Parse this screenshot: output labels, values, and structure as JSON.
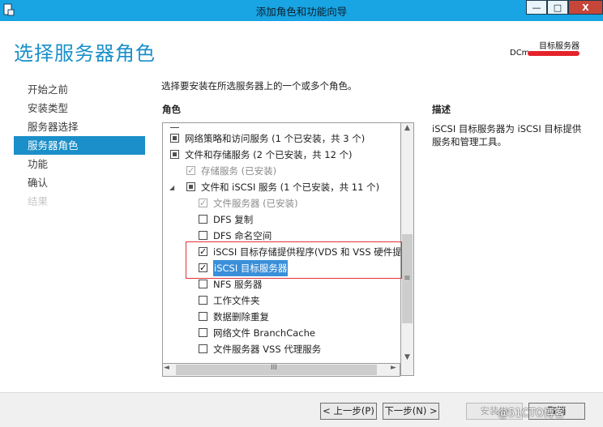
{
  "window": {
    "title": "添加角色和功能向导",
    "minimize": "—",
    "maximize": "□",
    "close": "X"
  },
  "header": {
    "page_title": "选择服务器角色",
    "target_label": "目标服务器",
    "target_name": "DCm"
  },
  "nav": {
    "items": [
      {
        "label": "开始之前",
        "state": "normal"
      },
      {
        "label": "安装类型",
        "state": "normal"
      },
      {
        "label": "服务器选择",
        "state": "normal"
      },
      {
        "label": "服务器角色",
        "state": "active"
      },
      {
        "label": "功能",
        "state": "normal"
      },
      {
        "label": "确认",
        "state": "normal"
      },
      {
        "label": "结果",
        "state": "disabled"
      }
    ]
  },
  "main": {
    "instruction": "选择要安装在所选服务器上的一个或多个角色。",
    "roles_heading": "角色",
    "description_heading": "描述",
    "description_text": "iSCSI 目标服务器为 iSCSI 目标提供服务和管理工具。",
    "roles": [
      {
        "label": "网络策略和访问服务 (1 个已安装，共 3 个)",
        "level": 0,
        "check": "partial",
        "expander": false,
        "dim": false,
        "selected": false
      },
      {
        "label": "文件和存储服务 (2 个已安装，共 12 个)",
        "level": 0,
        "check": "partial",
        "expander": false,
        "dim": false,
        "selected": false
      },
      {
        "label": "存储服务 (已安装)",
        "level": 1,
        "check": "checked-disabled",
        "expander": false,
        "dim": true,
        "selected": false
      },
      {
        "label": "文件和 iSCSI 服务 (1 个已安装，共 11 个)",
        "level": 1,
        "check": "partial",
        "expander": true,
        "dim": false,
        "selected": false
      },
      {
        "label": "文件服务器 (已安装)",
        "level": 2,
        "check": "checked-disabled",
        "expander": false,
        "dim": true,
        "selected": false
      },
      {
        "label": "DFS 复制",
        "level": 2,
        "check": "unchecked",
        "expander": false,
        "dim": false,
        "selected": false
      },
      {
        "label": "DFS 命名空间",
        "level": 2,
        "check": "unchecked",
        "expander": false,
        "dim": false,
        "selected": false
      },
      {
        "label": "iSCSI 目标存储提供程序(VDS 和 VSS 硬件提供",
        "level": 2,
        "check": "checked",
        "expander": false,
        "dim": false,
        "selected": false
      },
      {
        "label": "iSCSI 目标服务器",
        "level": 2,
        "check": "checked",
        "expander": false,
        "dim": false,
        "selected": true
      },
      {
        "label": "NFS 服务器",
        "level": 2,
        "check": "unchecked",
        "expander": false,
        "dim": false,
        "selected": false
      },
      {
        "label": "工作文件夹",
        "level": 2,
        "check": "unchecked",
        "expander": false,
        "dim": false,
        "selected": false
      },
      {
        "label": "数据删除重复",
        "level": 2,
        "check": "unchecked",
        "expander": false,
        "dim": false,
        "selected": false
      },
      {
        "label": "网络文件 BranchCache",
        "level": 2,
        "check": "unchecked",
        "expander": false,
        "dim": false,
        "selected": false
      },
      {
        "label": "文件服务器 VSS 代理服务",
        "level": 2,
        "check": "unchecked",
        "expander": false,
        "dim": false,
        "selected": false
      }
    ],
    "scroll_up": "▲",
    "scroll_down": "▼",
    "scroll_left": "◄",
    "scroll_right": "►",
    "scroll_grip_v": "≡",
    "scroll_grip_h": "III"
  },
  "footer": {
    "prev": "< 上一步(P)",
    "next": "下一步(N) >",
    "install": "安装(I)",
    "cancel": "取消",
    "watermark": "@51CTO博客"
  },
  "colors": {
    "accent": "#1a8fc9",
    "titlebar": "#19a4e3",
    "highlight_box": "#e0333a",
    "selection": "#3a8fd9"
  }
}
